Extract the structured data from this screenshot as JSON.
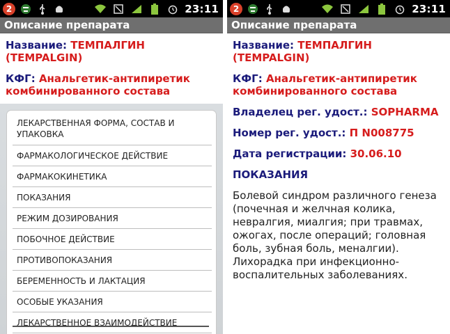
{
  "status_bar": {
    "notification_count": "2",
    "time": "23:11"
  },
  "left": {
    "title": "Описание препарата",
    "name_label": "Название:",
    "name_value": "ТЕМПАЛГИН (TEMPALGIN)",
    "kfg_label": "КФГ:",
    "kfg_value": "Анальгетик-антипиретик комбинированного состава",
    "menu_items": [
      "ЛЕКАРСТВЕННАЯ ФОРМА, СОСТАВ И УПАКОВКА",
      "ФАРМАКОЛОГИЧЕСКОЕ ДЕЙСТВИЕ",
      "ФАРМАКОКИНЕТИКА",
      "ПОКАЗАНИЯ",
      "РЕЖИМ ДОЗИРОВАНИЯ",
      "ПОБОЧНОЕ ДЕЙСТВИЕ",
      "ПРОТИВОПОКАЗАНИЯ",
      "БЕРЕМЕННОСТЬ И ЛАКТАЦИЯ",
      "ОСОБЫЕ УКАЗАНИЯ",
      "ЛЕКАРСТВЕННОЕ ВЗАИМОДЕЙСТВИЕ"
    ]
  },
  "right": {
    "title": "Описание препарата",
    "name_label": "Название:",
    "name_value": "ТЕМПАЛГИН (TEMPALGIN)",
    "kfg_label": "КФГ:",
    "kfg_value": "Анальгетик-антипиретик комбинированного состава",
    "owner_label": "Владелец рег. удост.:",
    "owner_value": "SOPHARMA",
    "reg_no_label": "Номер рег. удост.:",
    "reg_no_value": "П N008775",
    "reg_date_label": "Дата регистрации:",
    "reg_date_value": "30.06.10",
    "section_heading": "ПОКАЗАНИЯ",
    "description": "Болевой синдром различного генеза (почечная и желчная колика, невралгия, миалгия; при травмах, ожогах, после операций; головная боль, зубная боль, меналгии). Лихорадка при инфекционно-воспалительных заболеваниях."
  },
  "colors": {
    "label": "#1b1b7b",
    "value": "#d61d1d",
    "titlebar": "#6f6f6f",
    "badge": "#d9412a"
  }
}
